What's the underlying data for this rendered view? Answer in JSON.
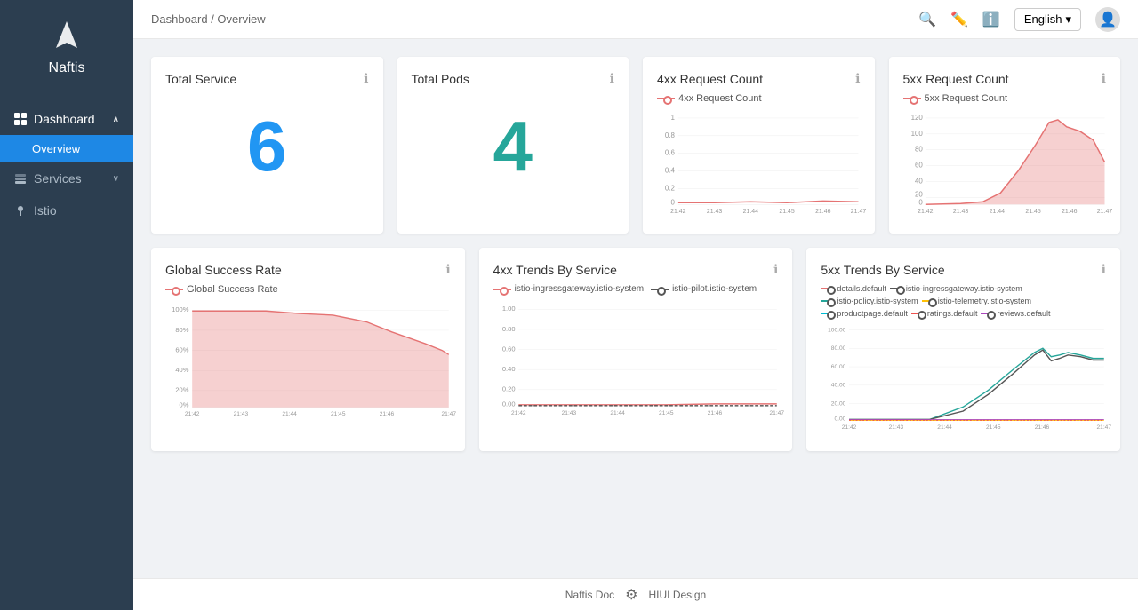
{
  "app": {
    "name": "Naftis",
    "logo_alt": "Naftis logo"
  },
  "header": {
    "breadcrumb": "Dashboard / Overview",
    "language": "English",
    "language_chevron": "▾"
  },
  "sidebar": {
    "items": [
      {
        "id": "dashboard",
        "label": "Dashboard",
        "icon": "grid",
        "has_children": true,
        "expanded": true
      },
      {
        "id": "overview",
        "label": "Overview",
        "is_sub": true,
        "active": true
      },
      {
        "id": "services",
        "label": "Services",
        "icon": "layers",
        "has_children": true,
        "expanded": false
      },
      {
        "id": "istio",
        "label": "Istio",
        "icon": "pin",
        "has_children": false
      }
    ]
  },
  "metrics": {
    "total_service": {
      "title": "Total Service",
      "value": "6"
    },
    "total_pods": {
      "title": "Total Pods",
      "value": "4"
    },
    "req_4xx": {
      "title": "4xx Request Count",
      "legend": "4xx Request Count",
      "y_labels": [
        "1",
        "0.8",
        "0.6",
        "0.4",
        "0.2",
        "0"
      ],
      "x_labels": [
        "21:42",
        "21:43",
        "21:44",
        "21:45",
        "21:46",
        "21:47"
      ]
    },
    "req_5xx": {
      "title": "5xx Request Count",
      "legend": "5xx Request Count",
      "y_labels": [
        "120",
        "100",
        "80",
        "60",
        "40",
        "20",
        "0"
      ],
      "x_labels": [
        "21:42",
        "21:43",
        "21:44",
        "21:45",
        "21:46",
        "21:47"
      ]
    },
    "global_success": {
      "title": "Global Success Rate",
      "legend": "Global Success Rate",
      "y_labels": [
        "100%",
        "80%",
        "60%",
        "40%",
        "20%",
        "0%"
      ],
      "x_labels": [
        "21:42",
        "21:43",
        "21:44",
        "21:45",
        "21:46",
        "21:47"
      ]
    },
    "trends_4xx": {
      "title": "4xx Trends By Service",
      "legends": [
        "istio-ingressgateway.istio-system",
        "istio-pilot.istio-system"
      ],
      "y_labels": [
        "1.00",
        "0.80",
        "0.60",
        "0.40",
        "0.20",
        "0.00"
      ],
      "x_labels": [
        "21:42",
        "21:43",
        "21:44",
        "21:45",
        "21:46",
        "21:47"
      ]
    },
    "trends_5xx": {
      "title": "5xx Trends By Service",
      "legends": [
        "details.default",
        "istio-ingressgateway.istio-system",
        "istio-policy.istio-system",
        "istio-telemetry.istio-system",
        "productpage.default",
        "ratings.default",
        "reviews.default"
      ],
      "y_labels": [
        "100.00",
        "80.00",
        "60.00",
        "40.00",
        "20.00",
        "0.00"
      ],
      "x_labels": [
        "21:42",
        "21:43",
        "21:44",
        "21:45",
        "21:46",
        "21:47"
      ]
    }
  },
  "footer": {
    "doc_label": "Naftis Doc",
    "design_label": "HIUI Design"
  }
}
